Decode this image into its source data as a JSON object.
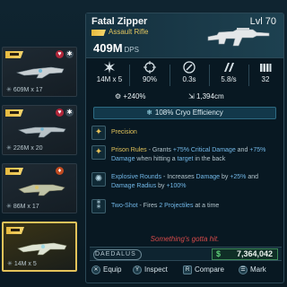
{
  "weapon_list": [
    {
      "stat": "609M x 17",
      "selected": false
    },
    {
      "stat": "226M x 20",
      "selected": false
    },
    {
      "stat": "86M x 17",
      "selected": false
    },
    {
      "stat": "14M x 5",
      "selected": true
    }
  ],
  "detail": {
    "name": "Fatal Zipper",
    "level": "Lvl 70",
    "type": "Assault Rifle",
    "dps_value": "409M",
    "dps_unit": "DPS",
    "stats": [
      {
        "icon": "damage-icon",
        "value": "14M x 5"
      },
      {
        "icon": "accuracy-icon",
        "value": "90%"
      },
      {
        "icon": "reload-icon",
        "value": "0.3s"
      },
      {
        "icon": "fire-rate-icon",
        "value": "5.8/s"
      },
      {
        "icon": "magazine-icon",
        "value": "32"
      }
    ],
    "bonuses": [
      {
        "icon": "crit-damage-icon",
        "value": "+240%"
      },
      {
        "icon": "range-icon",
        "value": "1,394cm"
      }
    ],
    "element_bar": "108% Cryo Efficiency",
    "perks": [
      {
        "name": "Precision",
        "desc": ""
      },
      {
        "name": "Prison Rules",
        "desc": " - Grants ",
        "desc_parts": [
          "+75% Critical Damage",
          " and ",
          "+75% Damage",
          " when hitting a ",
          "target",
          " in the back"
        ]
      },
      {
        "name": "Explosive Rounds",
        "desc_parts": [
          " - Increases ",
          "Damage",
          " by ",
          "+25%",
          " and ",
          "Damage Radius",
          " by ",
          "+100%"
        ]
      },
      {
        "name": "Two-Shot",
        "desc_parts": [
          " - Fires ",
          "2 Projectiles",
          " at a time"
        ]
      }
    ],
    "flavor": "Something's gotta hit.",
    "manufacturer": "DAEDALUS",
    "price": "7,364,042",
    "currency_symbol": "$",
    "actions": [
      {
        "key": "✕",
        "label": "Equip"
      },
      {
        "key": "Y",
        "label": "Inspect"
      },
      {
        "key": "R",
        "label": "Compare"
      },
      {
        "key": "☰",
        "label": "Mark"
      }
    ]
  },
  "colors": {
    "legendary": "#e3c35a",
    "highlight_blue": "#72b8e8",
    "flavor_red": "#d64a4a",
    "money_green": "#5fd07a"
  }
}
